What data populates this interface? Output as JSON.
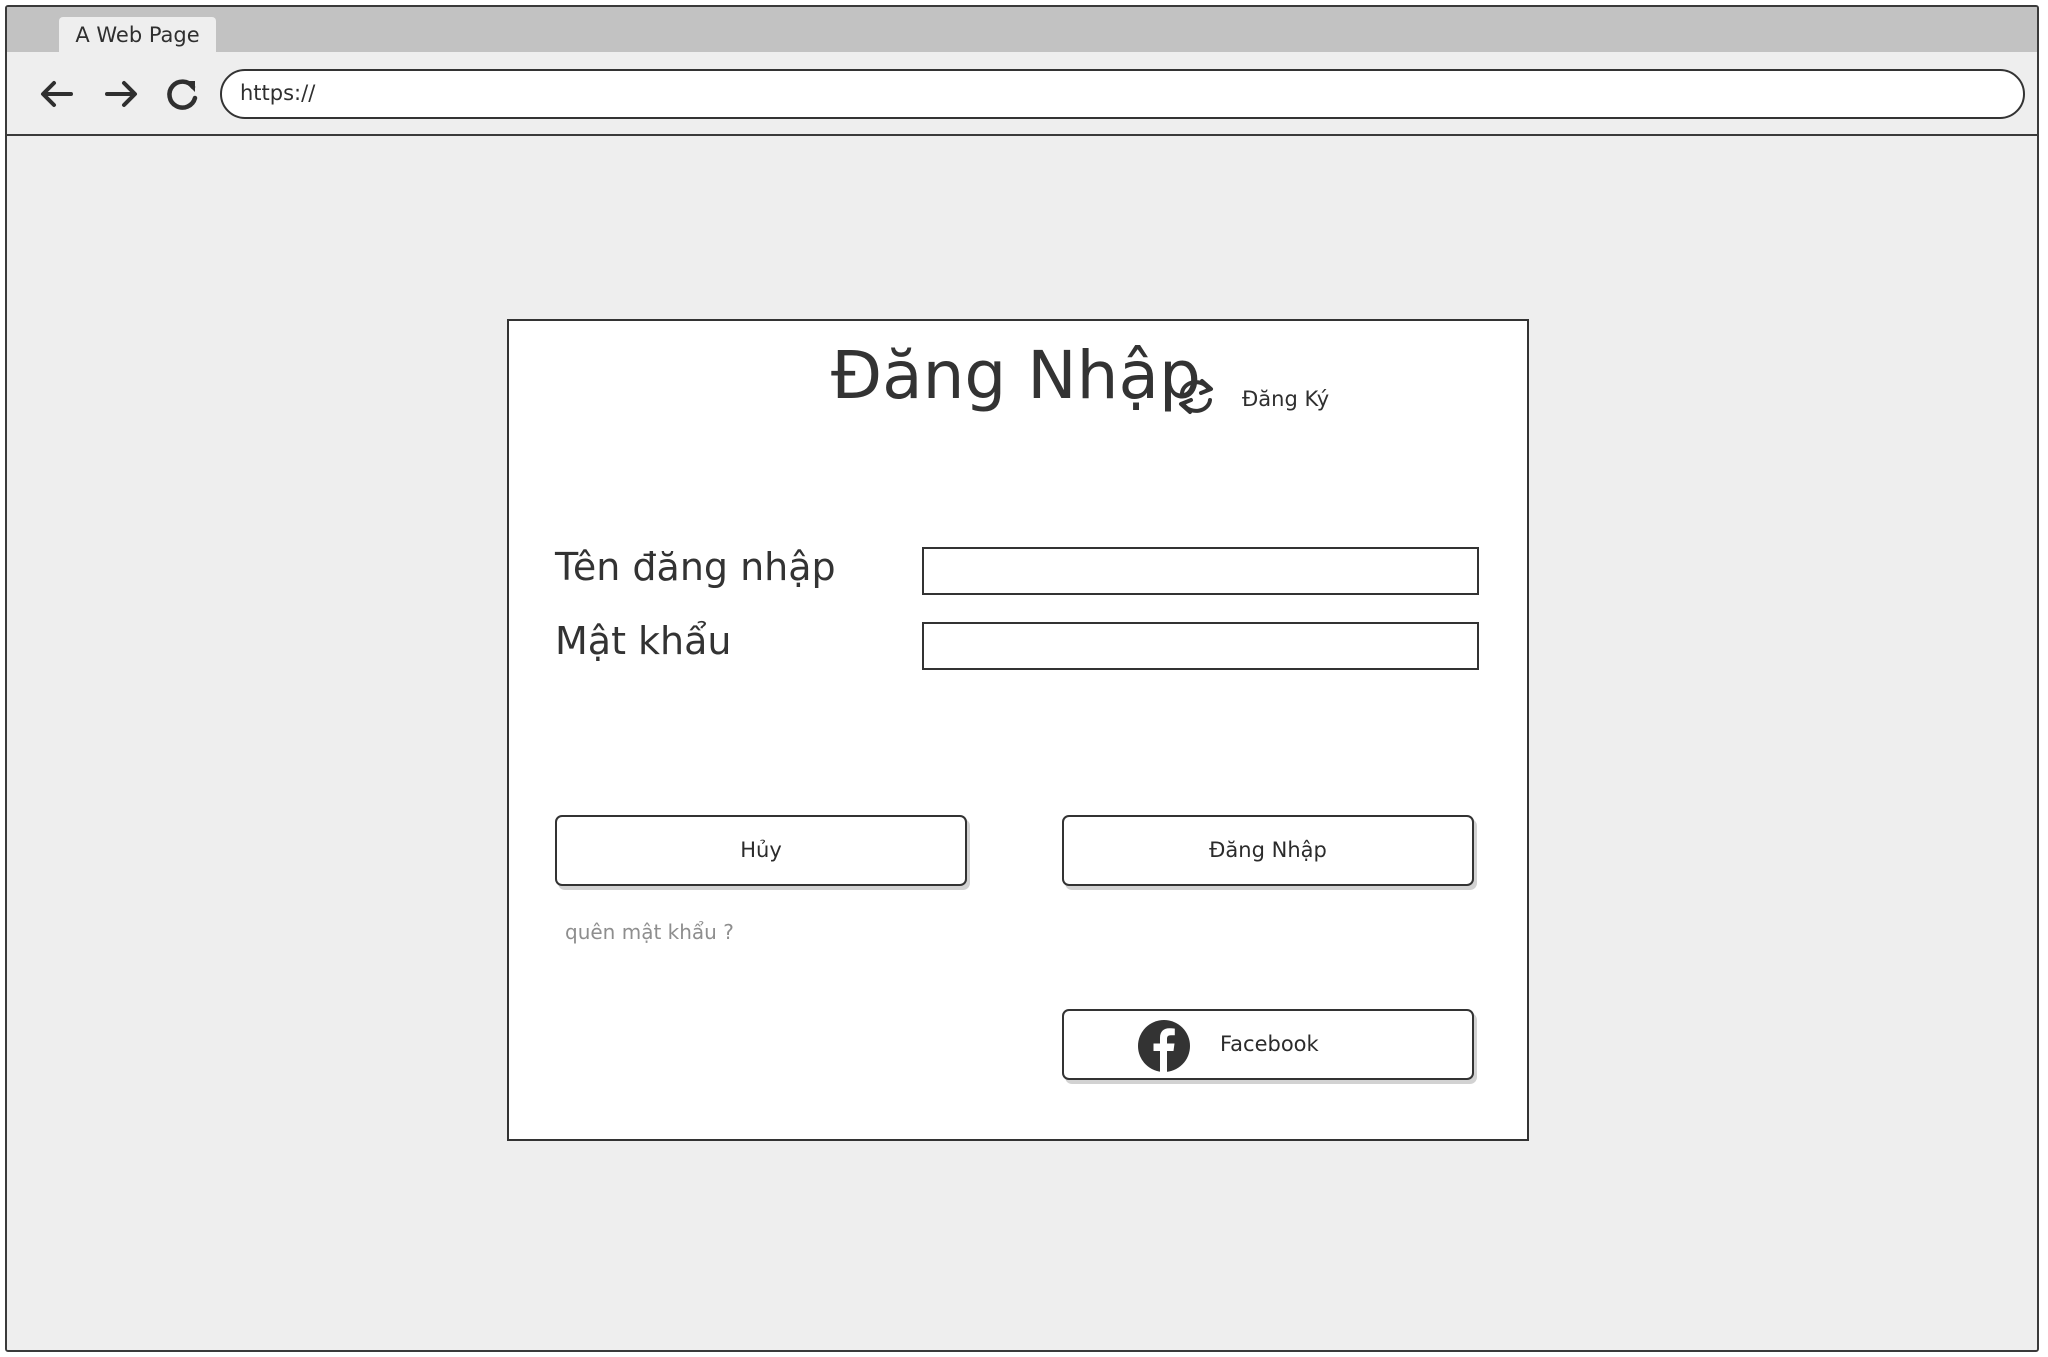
{
  "browser": {
    "tab_title": "A Web Page",
    "url": "https://"
  },
  "icons": {
    "back": "arrow-left-icon",
    "forward": "arrow-right-icon",
    "reload": "reload-icon",
    "swap": "swap-icon",
    "facebook": "facebook-icon"
  },
  "login": {
    "title": "Đăng Nhập",
    "register_link": "Đăng Ký",
    "username_label": "Tên đăng nhập",
    "username_value": "",
    "password_label": "Mật khẩu",
    "password_value": "",
    "cancel_label": "Hủy",
    "submit_label": "Đăng Nhập",
    "forgot_label": "quên mật khẩu ?",
    "facebook_label": "Facebook"
  },
  "colors": {
    "window_bg": "#eeeeee",
    "tabstrip_bg": "#c2c2c2",
    "stroke": "#333333",
    "muted_text": "#8e8e8e"
  }
}
